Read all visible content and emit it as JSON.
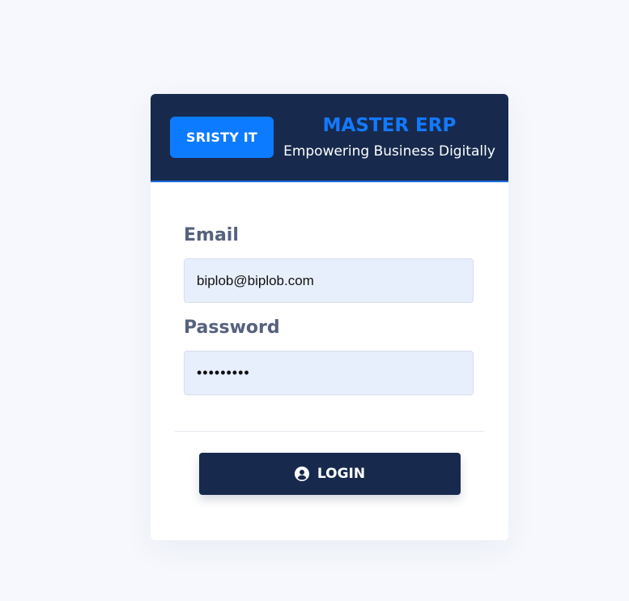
{
  "header": {
    "brand_label": "SRISTY IT",
    "app_title": "MASTER ERP",
    "tagline": "Empowering Business Digitally"
  },
  "form": {
    "email_label": "Email",
    "email_value": "biplob@biplob.com",
    "password_label": "Password",
    "password_masked": "•••••••••",
    "login_label": "LOGIN"
  },
  "icons": {
    "login_icon": "user-circle-icon"
  },
  "colors": {
    "background": "#f6f8fd",
    "header": "#172a4d",
    "brand_badge": "#0d7bff",
    "title_accent": "#1379ff",
    "input_fill": "#e8effc",
    "button": "#172a4d"
  }
}
